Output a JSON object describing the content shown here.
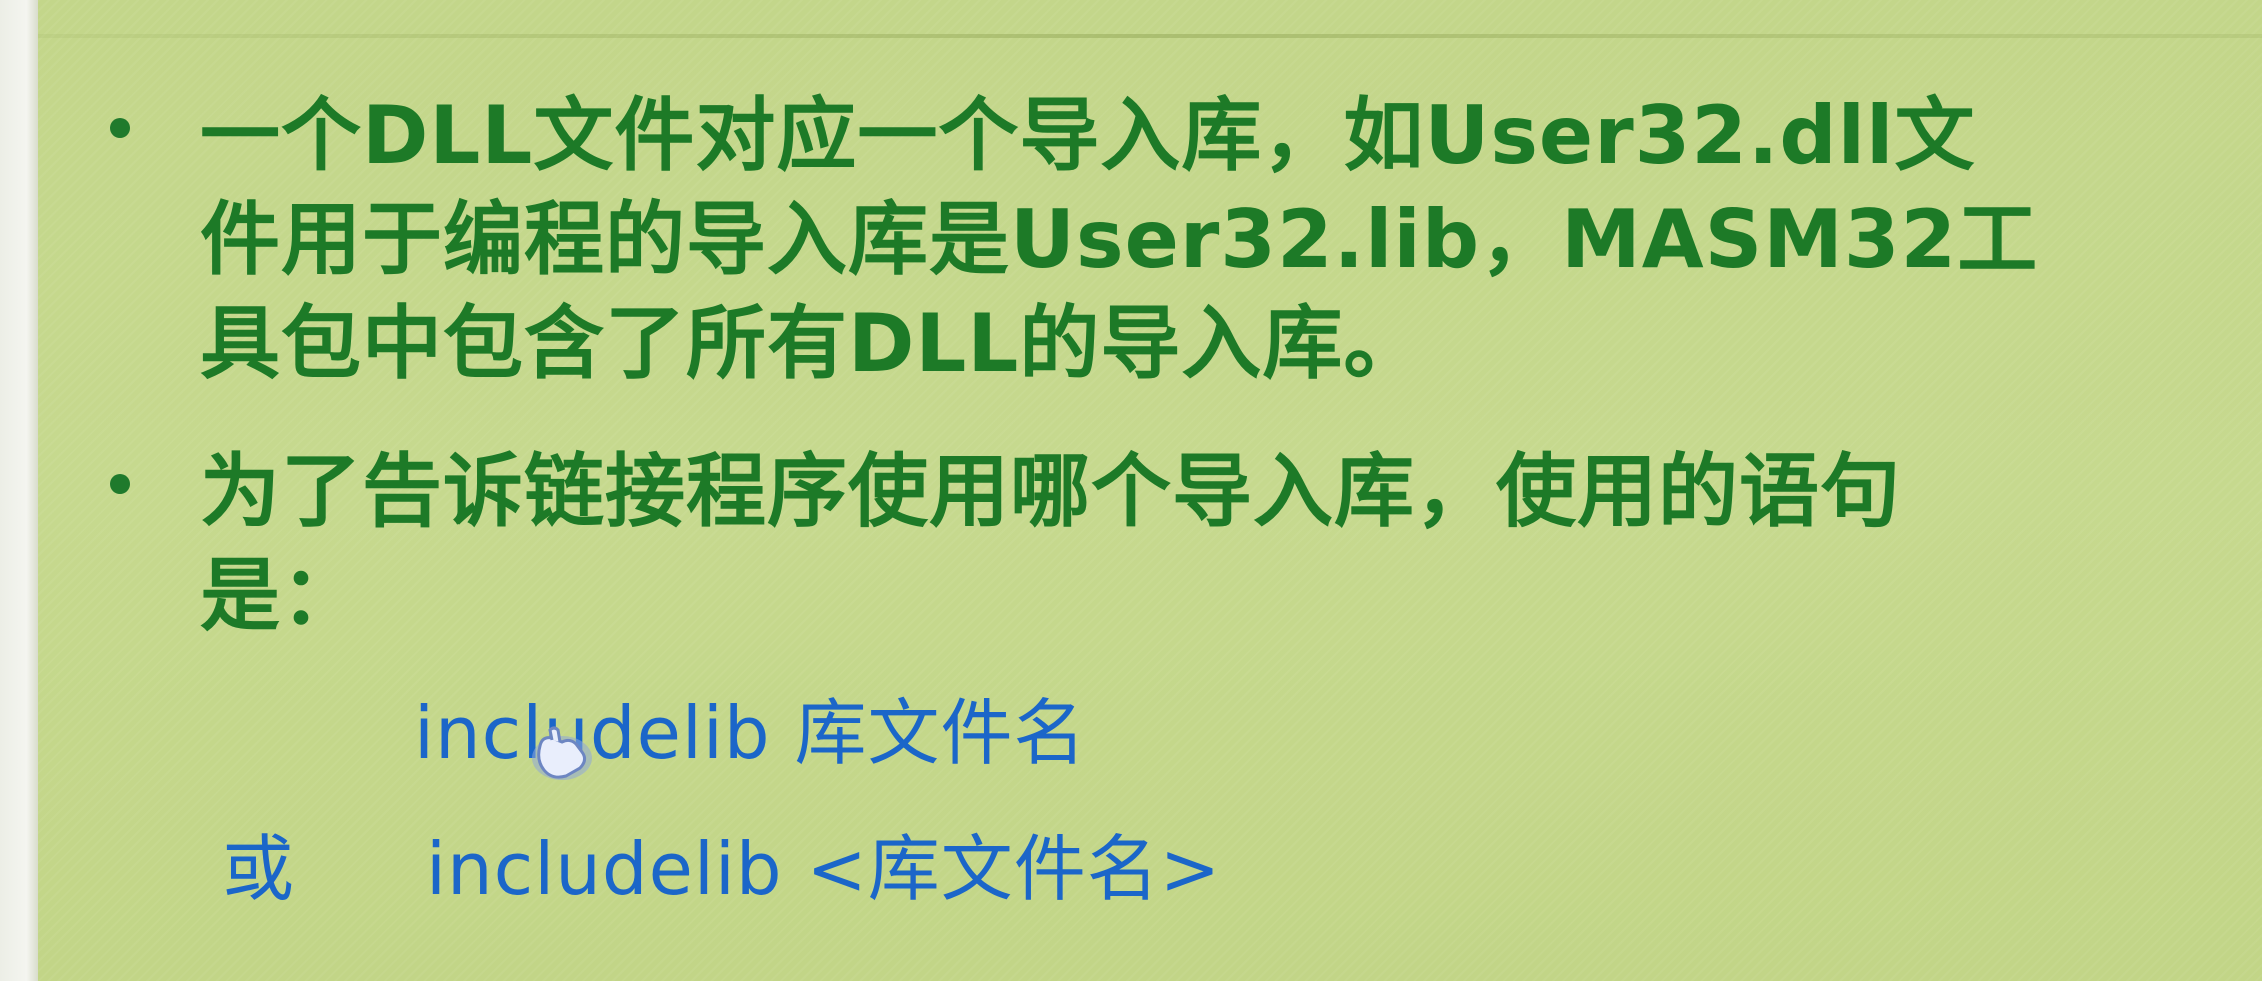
{
  "slide": {
    "bullet1": {
      "line1": "一个DLL文件对应一个导入库，如User32.dll文",
      "line2": "件用于编程的导入库是User32.lib，MASM32工",
      "line3": "具包中包含了所有DLL的导入库。"
    },
    "bullet2": {
      "line1": "为了告诉链接程序使用哪个导入库，使用的语句",
      "line2": "是："
    },
    "code": {
      "line1": "includelib  库文件名",
      "or_label": "或",
      "line2": "includelib <库文件名>"
    }
  },
  "colors": {
    "background": "#c6d98e",
    "text_green": "#1d7a27",
    "text_blue": "#1b66c9"
  },
  "icons": {
    "cursor": "hand-pointer-icon"
  }
}
